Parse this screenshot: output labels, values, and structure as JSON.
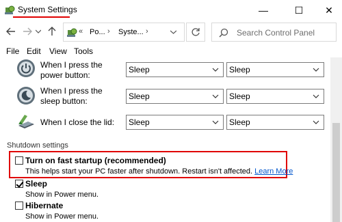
{
  "window": {
    "title": "System Settings",
    "minimize_glyph": "—",
    "maximize_glyph": "☐",
    "close_glyph": "✕",
    "accent_underline_color": "#e00000"
  },
  "nav": {
    "back_icon": "arrow-left-icon",
    "forward_icon": "arrow-right-icon",
    "up_icon": "arrow-up-icon",
    "address": {
      "overflow": "«",
      "crumbs": [
        "Po...",
        "Syste..."
      ],
      "separator": "›"
    },
    "refresh_icon": "refresh-icon",
    "search": {
      "placeholder": "Search Control Panel"
    }
  },
  "menu": {
    "items": [
      "File",
      "Edit",
      "View",
      "Tools"
    ]
  },
  "power_rows": [
    {
      "label": "When I press the power button:",
      "on_battery": "Sleep",
      "plugged_in": "Sleep",
      "icon": "power-button-icon"
    },
    {
      "label": "When I press the sleep button:",
      "on_battery": "Sleep",
      "plugged_in": "Sleep",
      "icon": "sleep-button-icon"
    },
    {
      "label": "When I close the lid:",
      "on_battery": "Sleep",
      "plugged_in": "Sleep",
      "icon": "laptop-lid-icon"
    }
  ],
  "shutdown": {
    "title": "Shutdown settings",
    "options": [
      {
        "label": "Turn on fast startup (recommended)",
        "checked": false,
        "description": "This helps start your PC faster after shutdown. Restart isn't affected.",
        "link": "Learn More",
        "highlighted": true
      },
      {
        "label": "Sleep",
        "checked": true,
        "description": "Show in Power menu."
      },
      {
        "label": "Hibernate",
        "checked": false,
        "description": "Show in Power menu."
      }
    ]
  }
}
